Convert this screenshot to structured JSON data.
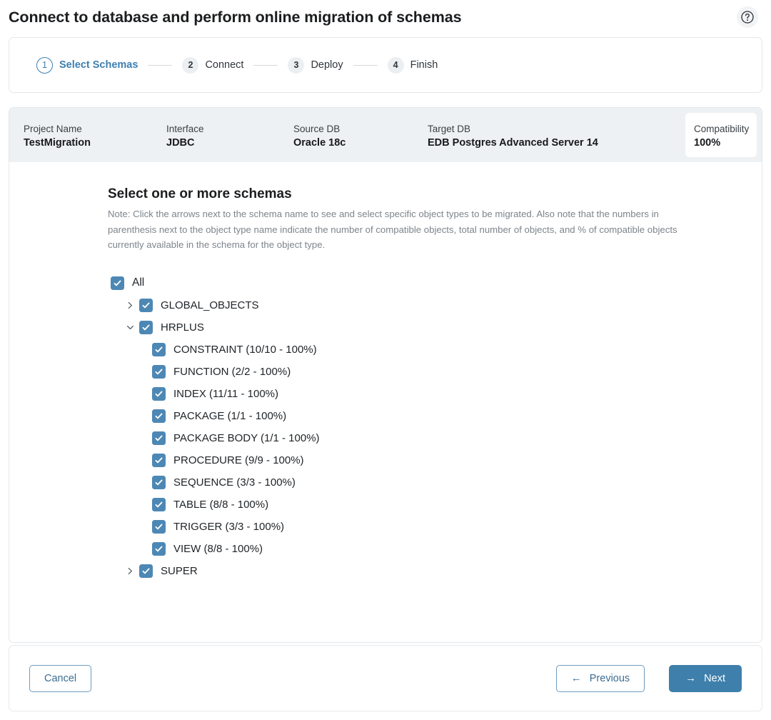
{
  "header": {
    "title": "Connect to database and perform online migration of schemas",
    "help_icon": "question-mark-circle-icon"
  },
  "stepper": {
    "steps": [
      {
        "number": "1",
        "label": "Select Schemas",
        "state": "active"
      },
      {
        "number": "2",
        "label": "Connect",
        "state": "idle"
      },
      {
        "number": "3",
        "label": "Deploy",
        "state": "idle"
      },
      {
        "number": "4",
        "label": "Finish",
        "state": "idle"
      }
    ]
  },
  "info_bar": {
    "items": [
      {
        "label": "Project Name",
        "value": "TestMigration"
      },
      {
        "label": "Interface",
        "value": "JDBC"
      },
      {
        "label": "Source DB",
        "value": "Oracle 18c"
      },
      {
        "label": "Target DB",
        "value": "EDB Postgres Advanced Server 14"
      }
    ],
    "compatibility": {
      "label": "Compatibility",
      "value": "100%"
    }
  },
  "main": {
    "section_title": "Select one or more schemas",
    "note": "Note: Click the arrows next to the schema name to see and select specific object types to be migrated. Also note that the numbers in parenthesis next to the object type name indicate the number of compatible objects, total number of objects, and % of compatible objects currently available in the schema for the object type.",
    "tree": [
      {
        "level": 0,
        "label": "All",
        "checked": true,
        "chevron": "none"
      },
      {
        "level": 1,
        "label": "GLOBAL_OBJECTS",
        "checked": true,
        "chevron": "right"
      },
      {
        "level": 1,
        "label": "HRPLUS",
        "checked": true,
        "chevron": "down"
      },
      {
        "level": 2,
        "label": "CONSTRAINT (10/10 - 100%)",
        "checked": true,
        "chevron": "none"
      },
      {
        "level": 2,
        "label": "FUNCTION (2/2 - 100%)",
        "checked": true,
        "chevron": "none"
      },
      {
        "level": 2,
        "label": "INDEX (11/11 - 100%)",
        "checked": true,
        "chevron": "none"
      },
      {
        "level": 2,
        "label": "PACKAGE (1/1 - 100%)",
        "checked": true,
        "chevron": "none"
      },
      {
        "level": 2,
        "label": "PACKAGE BODY (1/1 - 100%)",
        "checked": true,
        "chevron": "none"
      },
      {
        "level": 2,
        "label": "PROCEDURE (9/9 - 100%)",
        "checked": true,
        "chevron": "none"
      },
      {
        "level": 2,
        "label": "SEQUENCE (3/3 - 100%)",
        "checked": true,
        "chevron": "none"
      },
      {
        "level": 2,
        "label": "TABLE (8/8 - 100%)",
        "checked": true,
        "chevron": "none"
      },
      {
        "level": 2,
        "label": "TRIGGER (3/3 - 100%)",
        "checked": true,
        "chevron": "none"
      },
      {
        "level": 2,
        "label": "VIEW (8/8 - 100%)",
        "checked": true,
        "chevron": "none"
      },
      {
        "level": 1,
        "label": "SUPER",
        "checked": true,
        "chevron": "right"
      }
    ]
  },
  "footer": {
    "cancel_label": "Cancel",
    "previous_label": "Previous",
    "previous_arrow": "←",
    "next_label": "Next",
    "next_arrow": "→"
  },
  "colors": {
    "accent_blue": "#3f7fab",
    "checkbox_blue": "#4d88b5",
    "info_bar_bg": "#eef1f4",
    "step_idle_bg": "#eceff1"
  }
}
